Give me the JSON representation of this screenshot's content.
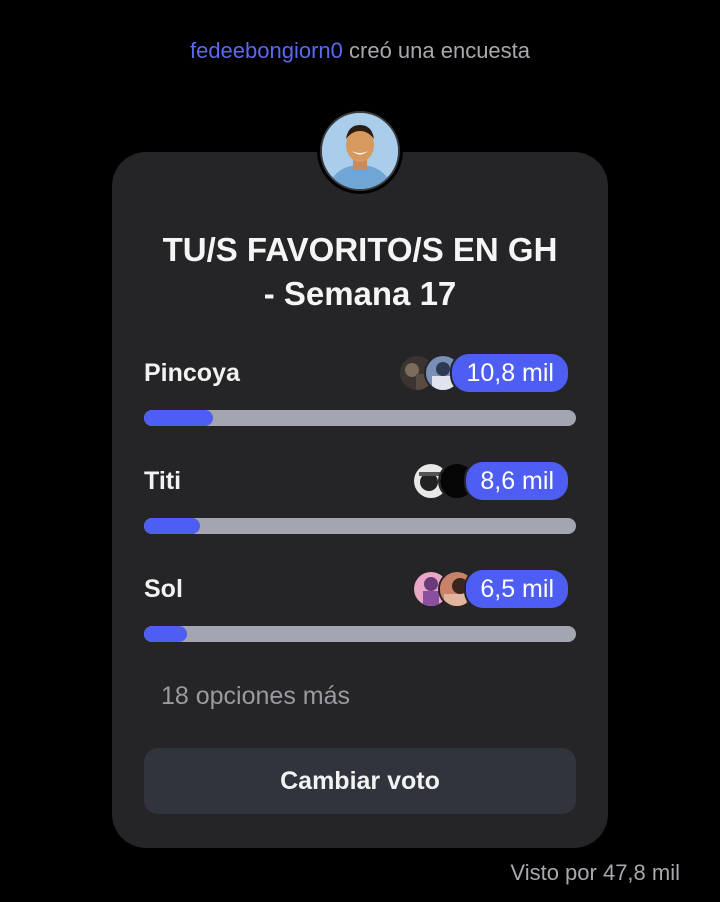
{
  "header": {
    "username": "fedeebongiorn0",
    "action_text": " creó una encuesta"
  },
  "poll": {
    "title_line1": "TU/S FAVORITO/S EN GH",
    "title_line2": "- Semana 17",
    "options": [
      {
        "label": "Pincoya",
        "count": "10,8 mil",
        "share": 0.16
      },
      {
        "label": "Titi",
        "count": "8,6 mil",
        "share": 0.13
      },
      {
        "label": "Sol",
        "count": "6,5 mil",
        "share": 0.1
      }
    ],
    "more_options": "18 opciones más",
    "change_vote": "Cambiar voto"
  },
  "footer": {
    "seen_by": "Visto por 47,8 mil"
  },
  "colors": {
    "accent": "#4e5ef3",
    "username": "#5b68f0",
    "card": "#252527",
    "bar_track": "#a3a6b0"
  },
  "icons": {
    "avatar": "creator-avatar",
    "voter_avatars": "voter-avatar"
  }
}
